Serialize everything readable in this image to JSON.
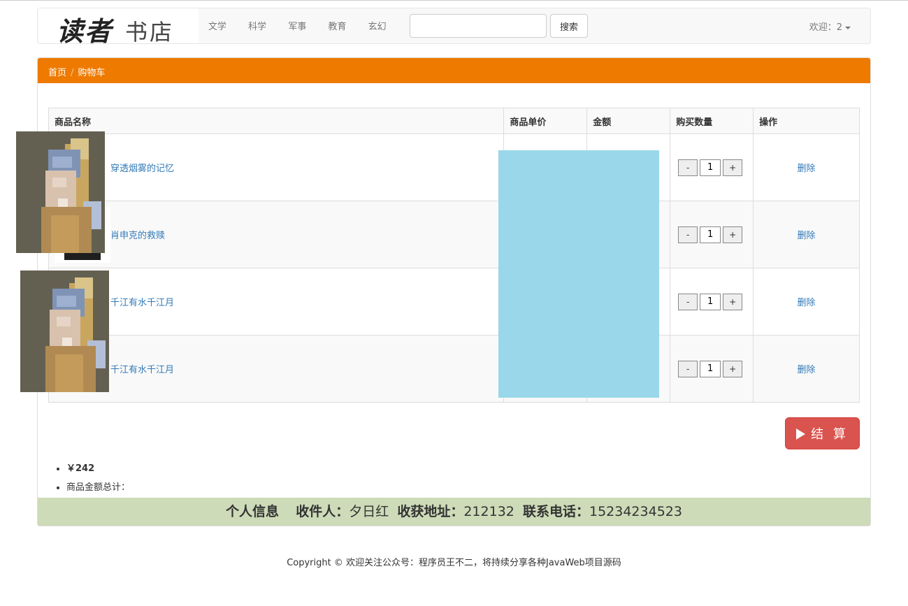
{
  "brand": {
    "logo_calligraphy": "读者",
    "logo_text": "书店"
  },
  "nav": {
    "links": [
      "文学",
      "科学",
      "军事",
      "教育",
      "玄幻"
    ]
  },
  "search": {
    "placeholder": "",
    "button": "搜索"
  },
  "user": {
    "welcome": "欢迎：2"
  },
  "breadcrumb": {
    "home": "首页",
    "sep": "/",
    "current": "购物车"
  },
  "table": {
    "headers": [
      "商品名称",
      "商品单价",
      "金额",
      "购买数量",
      "操作"
    ],
    "rows": [
      {
        "name": "穿透烟雾的记忆",
        "qty": "1",
        "delete": "删除"
      },
      {
        "name": "肖申克的救赎",
        "qty": "1",
        "delete": "删除"
      },
      {
        "name": "千江有水千江月",
        "qty": "1",
        "delete": "删除"
      },
      {
        "name": "千江有水千江月",
        "qty": "1",
        "delete": "删除"
      }
    ],
    "minus": "-",
    "plus": "+"
  },
  "checkout": {
    "label": "结 算"
  },
  "totals": {
    "price": "￥242",
    "label": "商品金额总计："
  },
  "info": {
    "title": "个人信息",
    "receiver_label": "收件人：",
    "receiver": "夕日红",
    "address_label": "收获地址：",
    "address": "212132",
    "phone_label": "联系电话：",
    "phone": "15234234523"
  },
  "footer": {
    "copyright": "Copyright © 欢迎关注公众号：程序员王不二，将持续分享各种JavaWeb项目源码"
  },
  "colors": {
    "heading": "#ee7a00",
    "checkout": "#d9534f",
    "info_bar": "#cddbb8",
    "link": "#337ab7",
    "blocker": "#9ad7ea"
  }
}
